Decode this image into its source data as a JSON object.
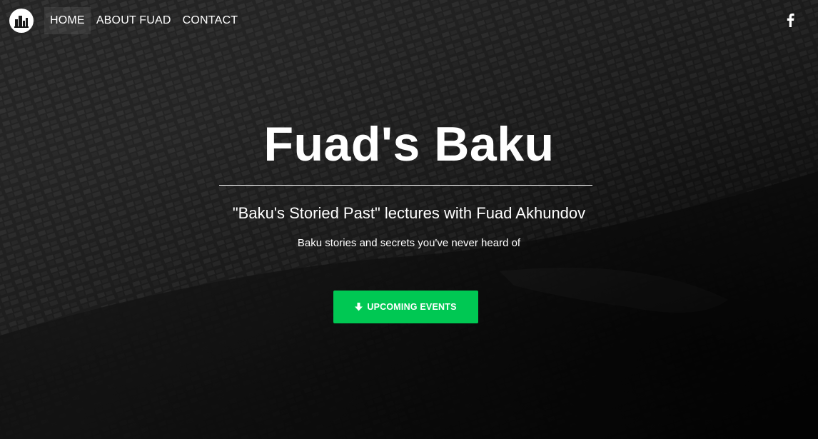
{
  "nav": {
    "logo_icon": "city-skyline-icon",
    "items": [
      {
        "label": "HOME",
        "active": true
      },
      {
        "label": "ABOUT FUAD",
        "active": false
      },
      {
        "label": "CONTACT",
        "active": false
      }
    ],
    "social_icon": "facebook-icon"
  },
  "hero": {
    "title": "Fuad's Baku",
    "subtitle": "\"Baku's Storied Past\" lectures with Fuad Akhundov",
    "tagline": "Baku stories and secrets you've never heard of",
    "cta_label": "UPCOMING EVENTS",
    "cta_icon": "arrow-down-icon"
  },
  "colors": {
    "accent": "#00c853",
    "text": "#ffffff"
  }
}
